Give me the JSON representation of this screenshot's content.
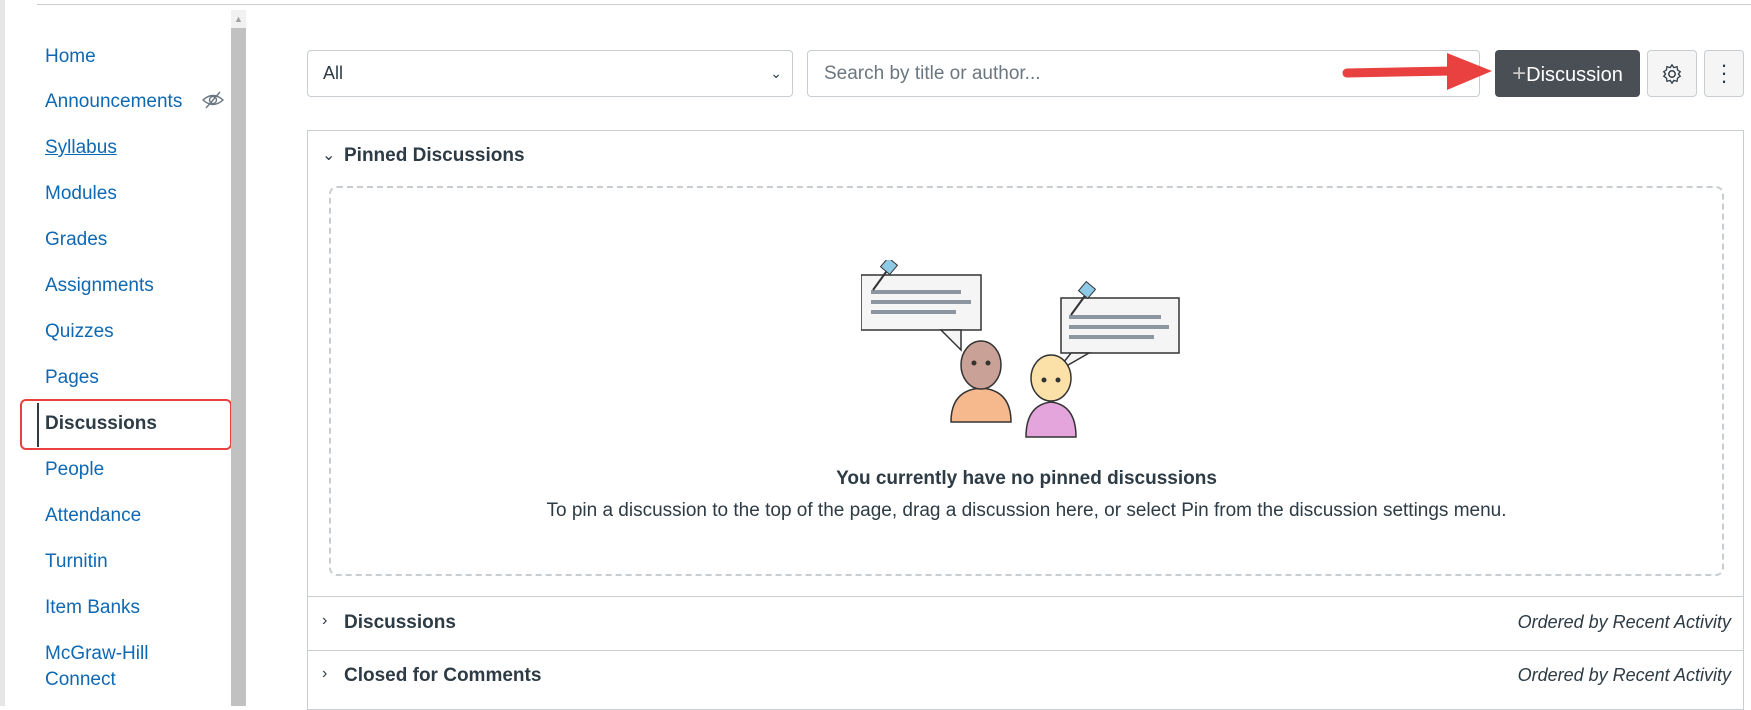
{
  "sidebar": {
    "items": [
      {
        "label": "Home"
      },
      {
        "label": "Announcements",
        "icon": "eye-off-icon"
      },
      {
        "label": "Syllabus"
      },
      {
        "label": "Modules"
      },
      {
        "label": "Grades"
      },
      {
        "label": "Assignments"
      },
      {
        "label": "Quizzes"
      },
      {
        "label": "Pages"
      },
      {
        "label": "Discussions",
        "active": true
      },
      {
        "label": "People"
      },
      {
        "label": "Attendance"
      },
      {
        "label": "Turnitin"
      },
      {
        "label": "Item Banks"
      },
      {
        "label": "McGraw-Hill",
        "label2": "Connect"
      }
    ]
  },
  "toolbar": {
    "filter_value": "All",
    "search_placeholder": "Search by title or author...",
    "add_plus": "+",
    "add_label": "Discussion",
    "settings_icon": "gear-icon",
    "more_icon": "kebab-icon"
  },
  "sections": {
    "pinned": {
      "title": "Pinned Discussions",
      "empty_title": "You currently have no pinned discussions",
      "empty_text": "To pin a discussion to the top of the page, drag a discussion here, or select Pin from the discussion settings menu."
    },
    "discussions": {
      "title": "Discussions",
      "order": "Ordered by Recent Activity"
    },
    "closed": {
      "title": "Closed for Comments",
      "order": "Ordered by Recent Activity"
    }
  },
  "colors": {
    "link": "#0e68b3",
    "button": "#4a4f56",
    "highlight": "#e8413f"
  }
}
